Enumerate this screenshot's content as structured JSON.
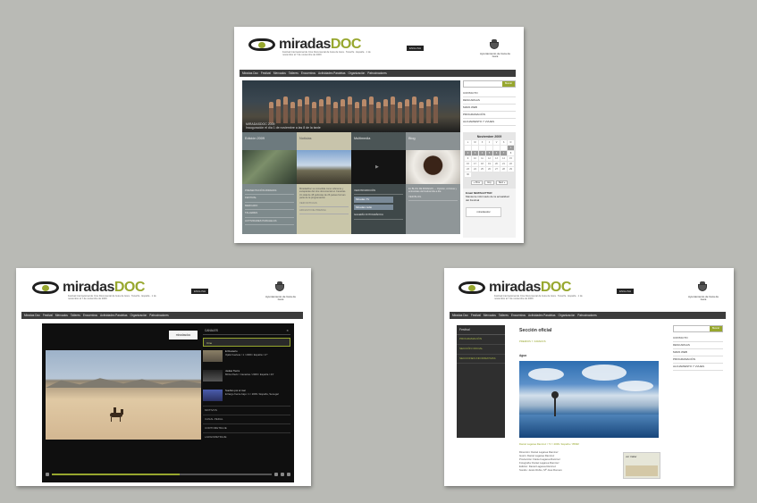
{
  "site": {
    "logo_main": "miradas",
    "logo_accent": "DOC",
    "tagline": "Festival Internacional de Cine Documental de Guía de Isora · Tenerife · España · 1 de noviembre al 7 de noviembre de 2009",
    "lang_label": "ENGLISH",
    "ayuntamiento": "Ayuntamiento de Guía de Isora"
  },
  "nav": [
    "Miradas Doc",
    "Festival",
    "Mercados",
    "Talleres",
    "Encuentros",
    "Actividades Paralelas",
    "Organización",
    "Patrocinadores"
  ],
  "screen1": {
    "hero_title": "MIRADASDOC 2009",
    "hero_sub": "Inauguración el día 1 de noviembre a las 8 de la tarde",
    "tiles": [
      {
        "title": "Edición 2009",
        "rows": [
          "PRESENTACIÓN MIRADAS",
          "FESTIVAL",
          "MERCADO",
          "TALLERES",
          "ACTIVIDADES PARALELAS"
        ]
      },
      {
        "title": "Noticias",
        "text": "MiradasDoc se consolida como referente y escaparate del cine documental en Canarias. Un total de 48 películas de 26 países forman parte de la programación",
        "rows": [
          "VER NOTICIAS",
          "ARCHIVO DE PRENSA"
        ]
      },
      {
        "title": "Multimedia",
        "rows": [
          "VER PROMOCIÓN"
        ],
        "buttons": [
          "Miradas TV",
          "Miradas radio"
        ],
        "foot": "GALERÍA FOTOGRÁFICA"
      },
      {
        "title": "Blog",
        "text": "EL BLOG DE MIRADAS — Opinión, crónicas y entrevistas del festival día a día",
        "foot": "VER BLOG"
      }
    ],
    "search_button": "Buscar",
    "links": [
      "CONTACTO",
      "DESCARGAS",
      "MAPA WEB",
      "PROGRAMACIÓN",
      "ALOJAMIENTO Y VIAJES"
    ],
    "calendar_title": "Noviembre 2009",
    "calendar_days": [
      "L",
      "M",
      "X",
      "J",
      "V",
      "S",
      "D",
      "",
      "",
      "",
      "",
      "",
      "",
      "1",
      "2",
      "3",
      "4",
      "5",
      "6",
      "7",
      "8",
      "9",
      "10",
      "11",
      "12",
      "13",
      "14",
      "15",
      "16",
      "17",
      "18",
      "19",
      "20",
      "21",
      "22",
      "23",
      "24",
      "25",
      "26",
      "27",
      "28",
      "29",
      "30"
    ],
    "calendar_nav": [
      "« Prev",
      "Hoy",
      "Next »"
    ],
    "newsletter_title": "Email NEWSLETTER",
    "newsletter_text": "Mantente informado de la actualidad del Festival",
    "newsletter_badge": "miradasdoc"
  },
  "screen2": {
    "brand": "miradasdoc",
    "playlist_head": "CANALES",
    "playlist_close": "✕",
    "selected": "Cine",
    "items": [
      {
        "title": "El Desierto",
        "meta": "Ojalá Vuelvas / 1 / 2009 / España / 17'"
      },
      {
        "title": "Jaulas Tierra",
        "meta": "Mirza Pavic / Canarias / 2009 / España / 23'"
      },
      {
        "title": "Sueños por el mar",
        "meta": "El largo frente bajo / 1 / 2009 / España, Senegal"
      }
    ],
    "cats": [
      "MOTIVOS",
      "CANAL PEDAL",
      "CORTOMETRAJE",
      "LARGOMETRAJE"
    ]
  },
  "screen3": {
    "side_title": "Festival",
    "side_items": [
      "PROGRAMACIÓN",
      "SECCIÓN OFICIAL",
      "SECCIONES INFORMATIVAS"
    ],
    "title": "Sección oficial",
    "subtitle": "PREMIOS Y JURADOS",
    "film_heading": "Agua",
    "caption": "Daniel Lagarea Ramírez / 71' / 2009 / España / 35MM",
    "credits": [
      "Dirección: Daniel Lagarea Ramírez",
      "Guión: Daniel Lagarea Ramírez",
      "Producción: Daniel Lagarea Ramírez",
      "Fotografía: Daniel Lagarea Ramírez",
      "Edición: Daniel Lagarea Ramírez",
      "Sonido: Jesús Rubio, Mª José Romero"
    ],
    "trailer_label": "ver trailer"
  }
}
